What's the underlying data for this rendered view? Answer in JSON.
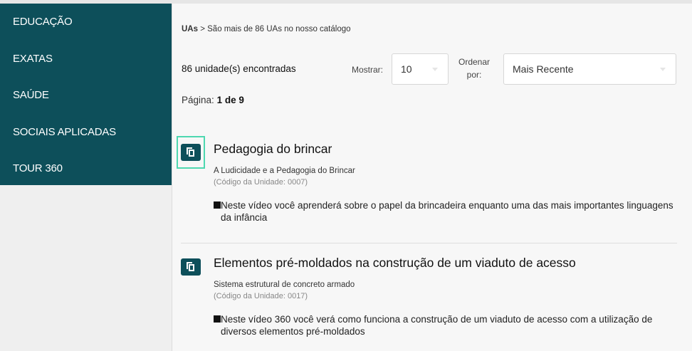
{
  "sidebar": {
    "items": [
      {
        "label": "EDUCAÇÃO"
      },
      {
        "label": "EXATAS"
      },
      {
        "label": "SAÚDE"
      },
      {
        "label": "SOCIAIS APLICADAS"
      },
      {
        "label": "TOUR 360"
      }
    ]
  },
  "breadcrumb": {
    "root": "UAs",
    "separator": ">",
    "text": "São mais de 86 UAs no nosso catálogo"
  },
  "toolbar": {
    "count": "86 unidade(s) encontradas",
    "show_label": "Mostrar:",
    "show_value": "10",
    "order_label_1": "Ordenar",
    "order_label_2": "por:",
    "order_value": "Mais Recente"
  },
  "pagination": {
    "label": "Página:",
    "value": "1 de 9"
  },
  "units": [
    {
      "title": "Pedagogia do brincar",
      "subtitle": "A Ludicidade e a Pedagogia do Brincar",
      "code": "(Código da Unidade: 0007)",
      "description": "Neste vídeo você aprenderá sobre o papel da brincadeira enquanto uma das mais importantes linguagens da infância",
      "icon": "copy-icon"
    },
    {
      "title": "Elementos pré-moldados na construção de um viaduto de acesso",
      "subtitle": "Sistema estrutural de concreto armado",
      "code": "(Código da Unidade: 0017)",
      "description": "Neste vídeo 360 você verá como funciona a construção de um viaduto de acesso com a utilização de diversos elementos pré-moldados",
      "icon": "copy-icon"
    }
  ],
  "colors": {
    "brand": "#0d4f5a",
    "focus": "#4ed8b0"
  }
}
